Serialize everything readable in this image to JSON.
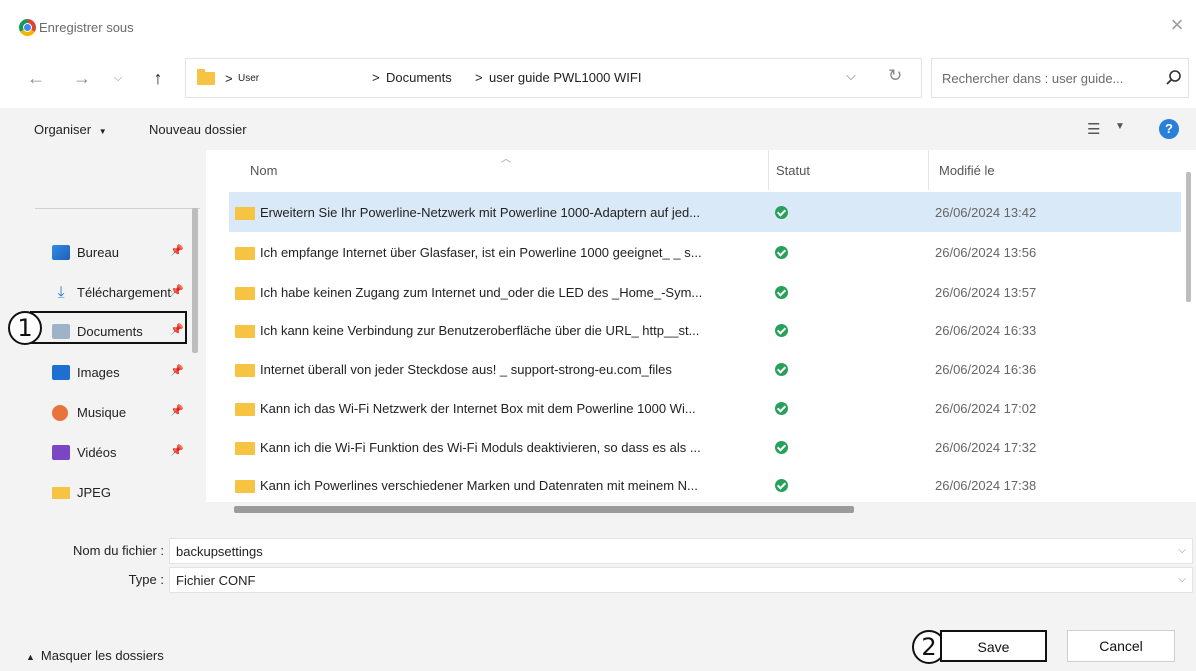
{
  "window": {
    "title": "Enregistrer sous",
    "close_icon": "close-icon"
  },
  "navigation": {
    "back_icon": "arrow-left-icon",
    "forward_icon": "arrow-right-icon",
    "recent_icon": "chevron-down-icon",
    "up_icon": "arrow-up-icon",
    "breadcrumb": [
      "User",
      "Documents",
      "user guide PWL1000 WIFI"
    ],
    "separator": ">",
    "refresh_icon": "refresh-icon",
    "search_placeholder": "Rechercher dans : user guide..."
  },
  "toolbar": {
    "organize": "Organiser",
    "new_folder": "Nouveau dossier",
    "view_icon": "view-options-icon",
    "help_icon": "help-icon",
    "help_glyph": "?"
  },
  "sidebar": {
    "items": [
      {
        "label": "Bureau",
        "icon": "desktop-icon",
        "pinned": true
      },
      {
        "label": "Téléchargements",
        "icon": "download-icon",
        "pinned": true
      },
      {
        "label": "Documents",
        "icon": "documents-icon",
        "pinned": true
      },
      {
        "label": "Images",
        "icon": "images-icon",
        "pinned": true
      },
      {
        "label": "Musique",
        "icon": "music-icon",
        "pinned": true
      },
      {
        "label": "Vidéos",
        "icon": "videos-icon",
        "pinned": true
      },
      {
        "label": "JPEG",
        "icon": "folder-icon",
        "pinned": false
      }
    ]
  },
  "annotations": {
    "marker_1": "1",
    "marker_2": "2"
  },
  "file_list": {
    "columns": [
      "Nom",
      "Statut",
      "Modifié le"
    ],
    "rows": [
      {
        "name": "Erweitern Sie Ihr Powerline-Netzwerk mit Powerline 1000-Adaptern auf jed...",
        "status": "synced",
        "modified": "26/06/2024 13:42",
        "selected": true
      },
      {
        "name": "Ich empfange Internet über Glasfaser, ist ein Powerline 1000 geeignet_ _ s...",
        "status": "synced",
        "modified": "26/06/2024 13:56",
        "selected": false
      },
      {
        "name": "Ich habe keinen Zugang zum Internet und_oder die LED des _Home_-Sym...",
        "status": "synced",
        "modified": "26/06/2024 13:57",
        "selected": false
      },
      {
        "name": "Ich kann keine Verbindung zur Benutzeroberfläche über die URL_ http__st...",
        "status": "synced",
        "modified": "26/06/2024 16:33",
        "selected": false
      },
      {
        "name": "Internet überall von jeder Steckdose aus! _ support-strong-eu.com_files",
        "status": "synced",
        "modified": "26/06/2024 16:36",
        "selected": false
      },
      {
        "name": "Kann ich das Wi-Fi Netzwerk der Internet Box mit dem Powerline 1000 Wi...",
        "status": "synced",
        "modified": "26/06/2024 17:02",
        "selected": false
      },
      {
        "name": "Kann ich die Wi-Fi Funktion des Wi-Fi Moduls deaktivieren, so dass es als ...",
        "status": "synced",
        "modified": "26/06/2024 17:32",
        "selected": false
      },
      {
        "name": "Kann ich Powerlines verschiedener Marken und Datenraten mit meinem N...",
        "status": "synced",
        "modified": "26/06/2024 17:38",
        "selected": false
      }
    ]
  },
  "form": {
    "filename_label": "Nom du fichier :",
    "filename_value": "backupsettings",
    "type_label": "Type :",
    "type_value": "Fichier CONF"
  },
  "footer": {
    "hide_folders": "Masquer les dossiers",
    "save": "Save",
    "cancel": "Cancel"
  },
  "colors": {
    "accent": "#2a7fd8",
    "selection": "#d9e9f7",
    "status_ok": "#26a15a",
    "folder": "#f6c342"
  }
}
